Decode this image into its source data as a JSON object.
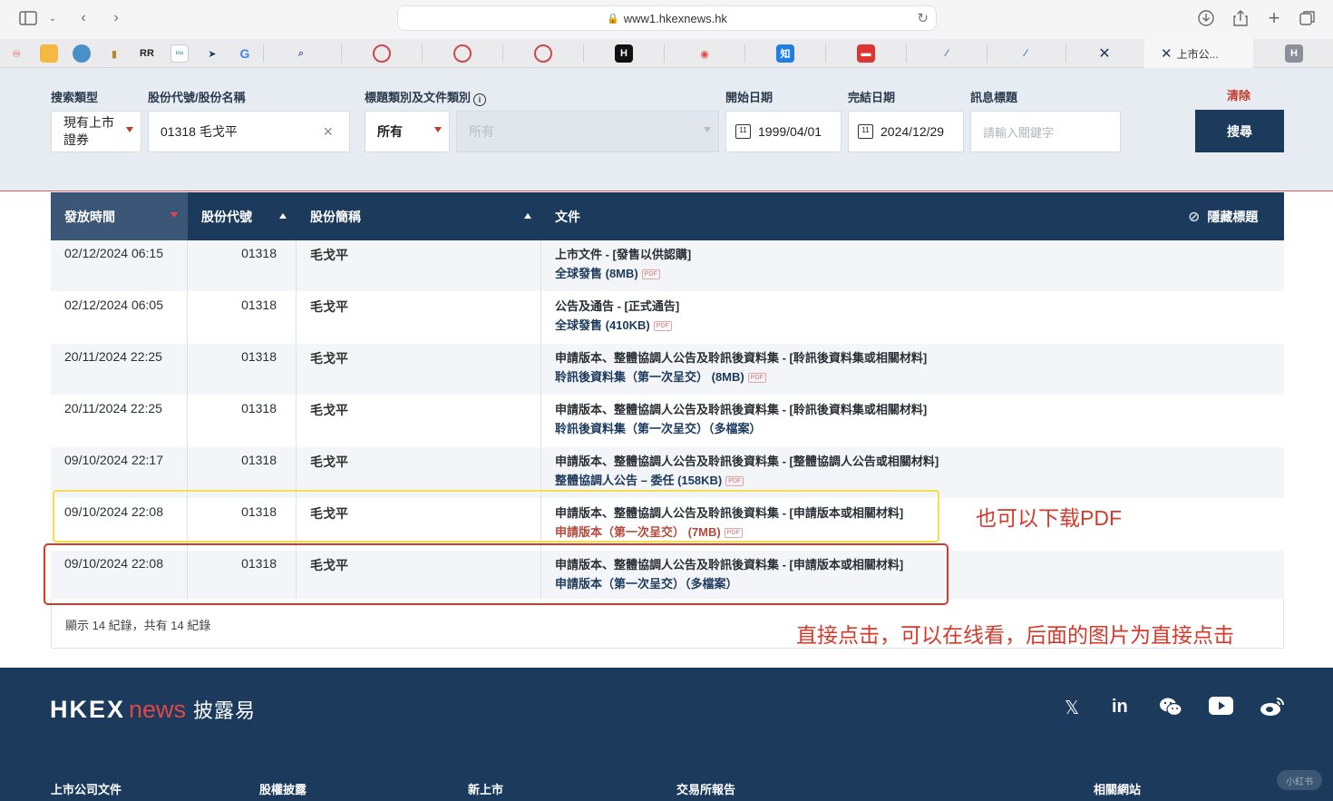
{
  "browser": {
    "url": "www1.hkexnews.hk",
    "active_tab_label": "上市公..."
  },
  "search": {
    "type_label": "搜索類型",
    "type_value": "現有上市證券",
    "stock_label": "股份代號/股份名稱",
    "stock_value": "01318 毛戈平",
    "category_label": "標題類別及文件類別",
    "category_value": "所有",
    "subcategory_placeholder": "所有",
    "start_label": "開始日期",
    "start_value": "1999/04/01",
    "end_label": "完結日期",
    "end_value": "2024/12/29",
    "keyword_label": "訊息標題",
    "keyword_placeholder": "請輸入關鍵字",
    "clear_label": "清除",
    "search_label": "搜尋"
  },
  "table": {
    "columns": [
      "發放時間",
      "股份代號",
      "股份簡稱",
      "文件"
    ],
    "hide_titles_label": "隱藏標題",
    "rows": [
      {
        "date": "02/12/2024 06:15",
        "code": "01318",
        "name": "毛戈平",
        "title": "上市文件 - [發售以供認購]",
        "link": "全球發售 (8MB)",
        "pdf": true
      },
      {
        "date": "02/12/2024 06:05",
        "code": "01318",
        "name": "毛戈平",
        "title": "公告及通告 - [正式通告]",
        "link": "全球發售 (410KB)",
        "pdf": true
      },
      {
        "date": "20/11/2024 22:25",
        "code": "01318",
        "name": "毛戈平",
        "title": "申請版本、整體協調人公告及聆訊後資料集 - [聆訊後資料集或相關材料]",
        "link": "聆訊後資料集（第一次呈交） (8MB)",
        "pdf": true
      },
      {
        "date": "20/11/2024 22:25",
        "code": "01318",
        "name": "毛戈平",
        "title": "申請版本、整體協調人公告及聆訊後資料集 - [聆訊後資料集或相關材料]",
        "link": "聆訊後資料集（第一次呈交）（多檔案）",
        "pdf": false
      },
      {
        "date": "09/10/2024 22:17",
        "code": "01318",
        "name": "毛戈平",
        "title": "申請版本、整體協調人公告及聆訊後資料集 - [整體協調人公告或相關材料]",
        "link": "整體協調人公告 – 委任 (158KB)",
        "pdf": true
      },
      {
        "date": "09/10/2024 22:08",
        "code": "01318",
        "name": "毛戈平",
        "title": "申請版本、整體協調人公告及聆訊後資料集 - [申請版本或相關材料]",
        "link": "申請版本（第一次呈交） (7MB)",
        "pdf": true
      },
      {
        "date": "09/10/2024 22:08",
        "code": "01318",
        "name": "毛戈平",
        "title": "申請版本、整體協調人公告及聆訊後資料集 - [申請版本或相關材料]",
        "link": "申請版本（第一次呈交）（多檔案）",
        "pdf": false
      }
    ],
    "pdf_badge": "PDF",
    "records_text": "顯示 14 紀錄，共有 14 紀錄"
  },
  "annotations": {
    "note_pdf": "也可以下载PDF",
    "note_click": "直接点击，可以在线看，后面的图片为直接点击"
  },
  "footer": {
    "logo_hkex": "HKEX",
    "logo_news": "news",
    "logo_cn": "披露易",
    "links": [
      "上市公司文件",
      "股權披露",
      "新上市",
      "交易所報告",
      "相關網站"
    ],
    "watermark": "小紅书"
  },
  "colors": {
    "navy": "#1b3a5c",
    "accent_red": "#d43a2b",
    "highlight_yellow": "#f4e04d"
  }
}
